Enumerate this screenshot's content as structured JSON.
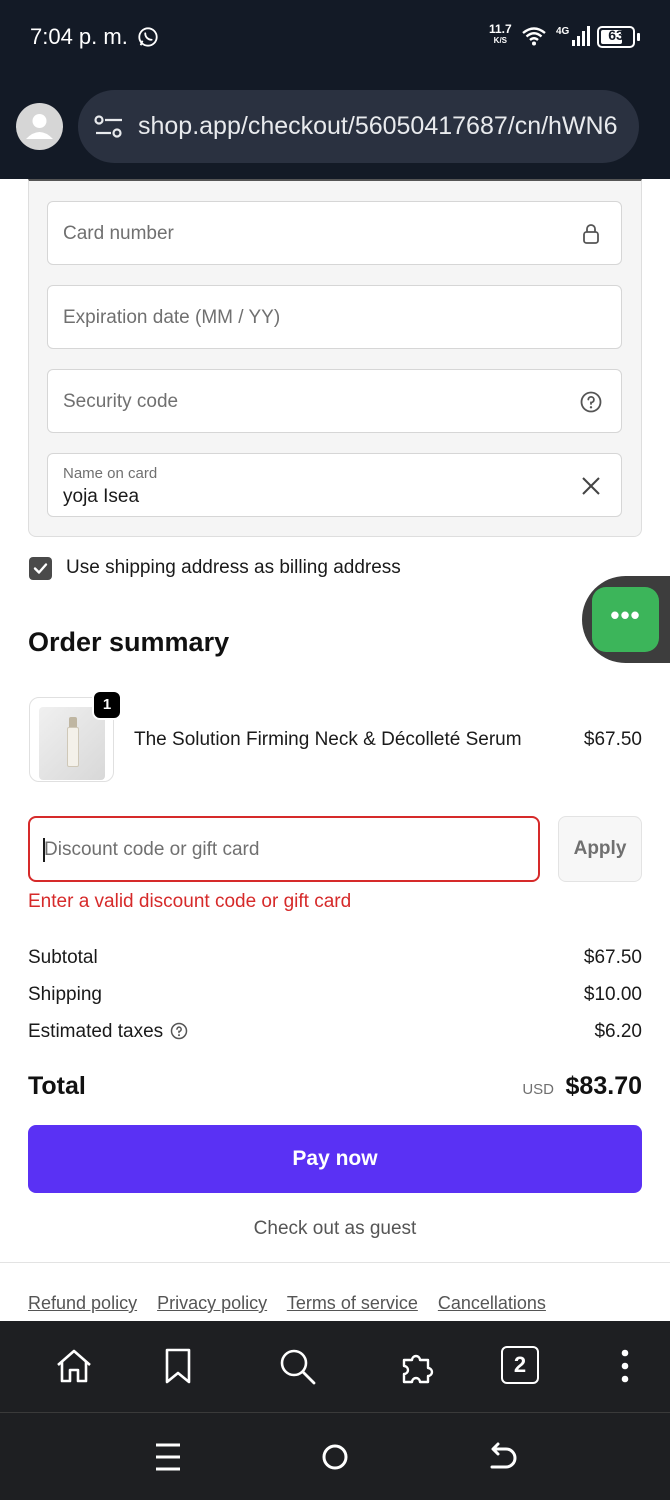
{
  "status_bar": {
    "time": "7:04 p. m.",
    "net_speed_value": "11.7",
    "net_speed_unit": "K/S",
    "network": "4G",
    "battery": "63"
  },
  "browser": {
    "url": "shop.app/checkout/56050417687/cn/hWN6"
  },
  "payment": {
    "card_number_placeholder": "Card number",
    "expiration_placeholder": "Expiration date (MM / YY)",
    "security_code_placeholder": "Security code",
    "name_label": "Name on card",
    "name_value": "yoja Isea",
    "billing_checkbox_label": "Use shipping address as billing address",
    "billing_checked": true
  },
  "order_summary": {
    "title": "Order summary",
    "items": [
      {
        "quantity": "1",
        "name": "The Solution Firming Neck & Décolleté Serum",
        "price": "$67.50"
      }
    ]
  },
  "discount": {
    "placeholder": "Discount code or gift card",
    "apply_label": "Apply",
    "error": "Enter a valid discount code or gift card"
  },
  "totals": {
    "subtotal_label": "Subtotal",
    "subtotal": "$67.50",
    "shipping_label": "Shipping",
    "shipping": "$10.00",
    "taxes_label": "Estimated taxes",
    "taxes": "$6.20",
    "total_label": "Total",
    "currency": "USD",
    "total": "$83.70"
  },
  "actions": {
    "pay_label": "Pay now",
    "guest_label": "Check out as guest"
  },
  "footer_links": [
    "Refund policy",
    "Privacy policy",
    "Terms of service",
    "Cancellations"
  ],
  "browser_toolbar": {
    "tab_count": "2"
  },
  "colors": {
    "primary_button": "#5a31f4",
    "error": "#d62a2a",
    "chat_button": "#3cb55a",
    "top_bar": "#131a26"
  }
}
